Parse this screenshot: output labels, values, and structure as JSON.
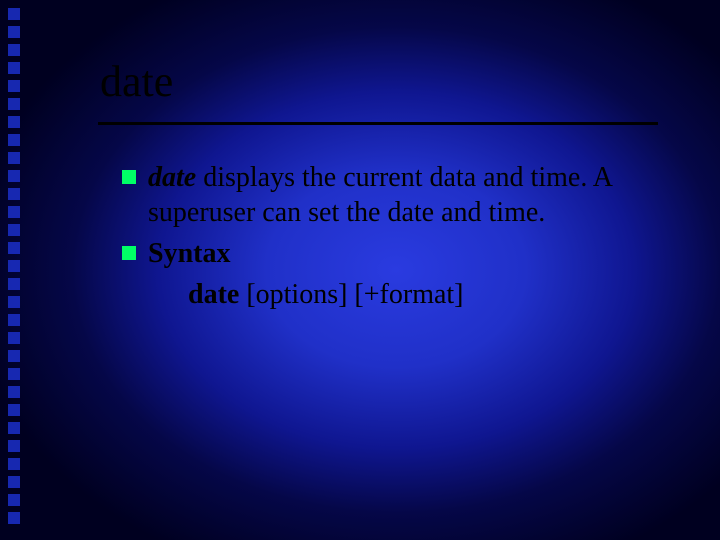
{
  "title": "date",
  "bullets": [
    {
      "leading_bold_italic": "date",
      "rest": " displays the current data and time. A superuser can set the date and time."
    },
    {
      "bold": "Syntax",
      "syntax_cmd": "date",
      "syntax_args": " [options] [+format]"
    }
  ]
}
